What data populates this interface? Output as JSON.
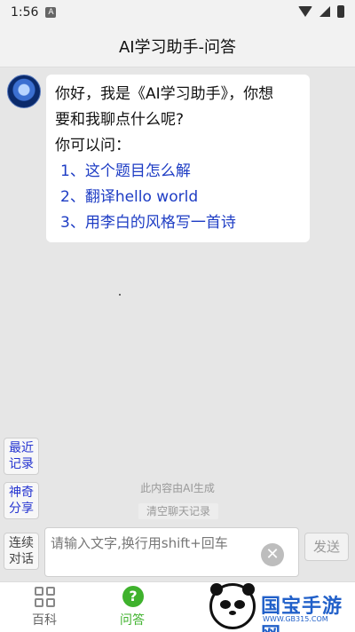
{
  "status_bar": {
    "time": "1:56",
    "app_indicator": "A"
  },
  "header": {
    "title": "AI学习助手-问答"
  },
  "chat": {
    "avatar_icon": "robot-avatar-icon",
    "message": {
      "line1": "你好，我是《AI学习助手》，你想",
      "line2": "要和我聊点什么呢?",
      "line3": "你可以问：",
      "suggestions": [
        "1、这个题目怎么解",
        "2、翻译hello world",
        "3、用李白的风格写一首诗"
      ]
    }
  },
  "side_buttons": {
    "recent_line1": "最近",
    "recent_line2": "记录",
    "share_line1": "神奇",
    "share_line2": "分享",
    "continuous_line1": "连续",
    "continuous_line2": "对话"
  },
  "notes": {
    "ai_generated": "此内容由AI生成",
    "clear_chat": "清空聊天记录"
  },
  "input": {
    "placeholder": "请输入文字,换行用shift+回车",
    "value": "",
    "send_label": "发送"
  },
  "tabs": [
    {
      "label": "百科",
      "icon": "grid-icon",
      "active": false
    },
    {
      "label": "问答",
      "icon": "question-icon",
      "active": true
    }
  ],
  "watermark": {
    "name": "国宝手游网",
    "url": "WWW.GB315.COM"
  },
  "colors": {
    "accent_blue": "#1d3cc4",
    "active_green": "#3fb22d",
    "background": "#e6e6e6"
  }
}
